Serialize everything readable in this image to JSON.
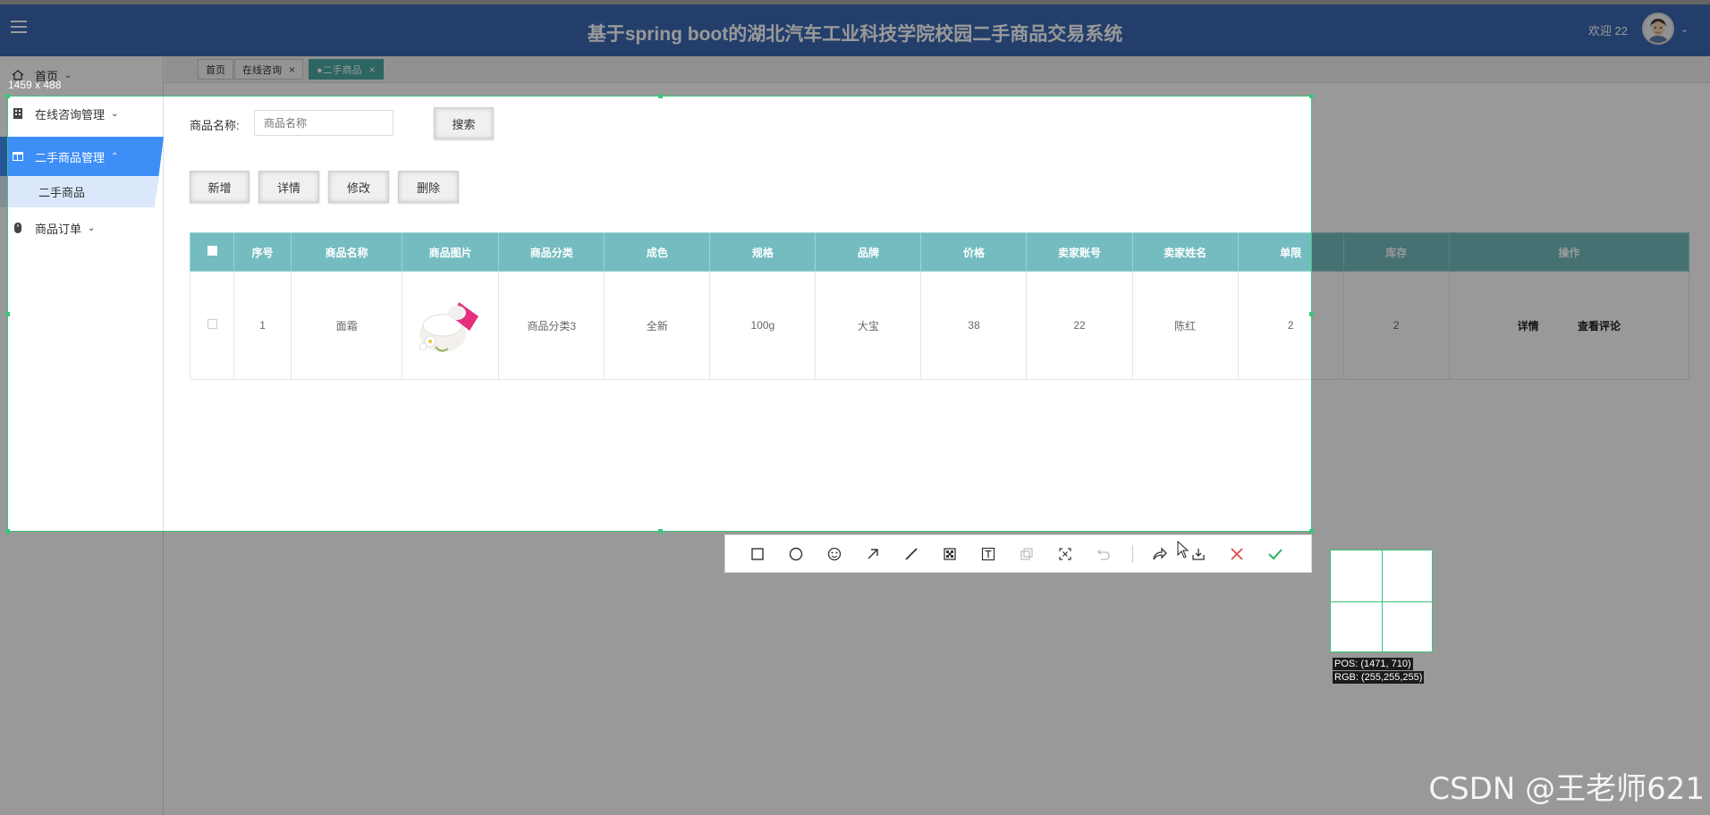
{
  "header": {
    "title": "基于spring boot的湖北汽车工业科技学院校园二手商品交易系统",
    "welcome": "欢迎 22"
  },
  "sidebar": {
    "items": [
      {
        "label": "首页"
      },
      {
        "label": "在线咨询管理"
      },
      {
        "label": "二手商品管理"
      },
      {
        "label": "商品订单"
      }
    ],
    "sub_item": "二手商品"
  },
  "tabs": [
    {
      "label": "首页"
    },
    {
      "label": "在线咨询"
    },
    {
      "label": "●二手商品"
    }
  ],
  "search": {
    "label": "商品名称:",
    "placeholder": "商品名称",
    "button": "搜索"
  },
  "actions": {
    "add": "新增",
    "detail": "详情",
    "edit": "修改",
    "delete": "删除"
  },
  "table": {
    "columns": [
      "序号",
      "商品名称",
      "商品图片",
      "商品分类",
      "成色",
      "规格",
      "品牌",
      "价格",
      "卖家账号",
      "卖家姓名",
      "单限",
      "库存",
      "操作"
    ],
    "rows": [
      {
        "index": "1",
        "name": "面霜",
        "category": "商品分类3",
        "condition": "全新",
        "spec": "100g",
        "brand": "大宝",
        "price": "38",
        "seller_account": "22",
        "seller_name": "陈红",
        "limit": "2",
        "stock": "2",
        "op_detail": "详情",
        "op_comments": "查看评论"
      }
    ]
  },
  "capture_tool": {
    "size_label": "1459 x 488",
    "pos": "POS: (1471, 710)",
    "rgb": "RGB: (255,255,255)",
    "tools": [
      "rectangle-icon",
      "ellipse-icon",
      "emoji-icon",
      "arrow-icon",
      "pen-icon",
      "mosaic-icon",
      "text-icon",
      "sticker-icon",
      "ocr-icon",
      "undo-icon",
      "share-icon",
      "save-icon",
      "cancel-icon",
      "confirm-icon"
    ]
  },
  "watermark": "CSDN @王老师621",
  "colors": {
    "header_bg": "#3b68b2",
    "active_sidebar": "#3e8ef7",
    "table_header": "#74bcc0",
    "active_tab": "#4aa9a4",
    "selection": "#3cc47c",
    "cancel": "#e34b4b",
    "confirm": "#28b463"
  }
}
